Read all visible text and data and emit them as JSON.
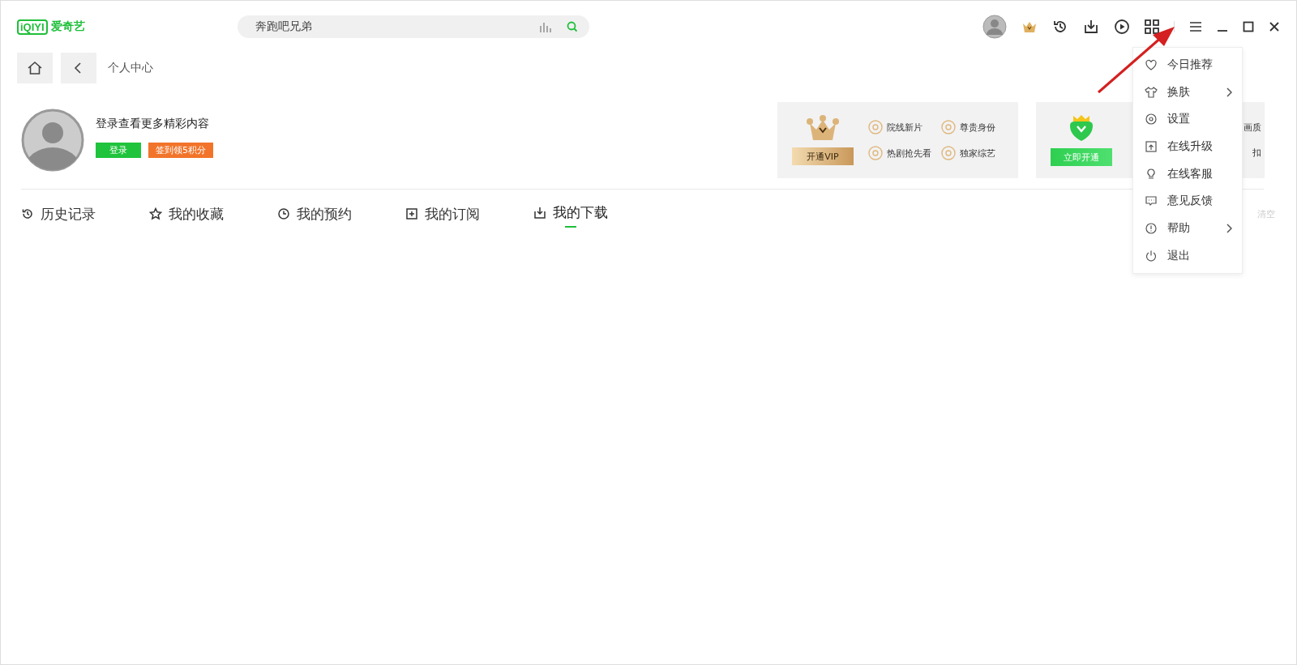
{
  "logo": {
    "mark": "iQIYI",
    "name": "爱奇艺"
  },
  "search": {
    "value": "奔跑吧兄弟"
  },
  "breadcrumb": {
    "title": "个人中心"
  },
  "profile": {
    "prompt": "登录查看更多精彩内容",
    "login_button": "登录",
    "checkin_button": "签到领5积分"
  },
  "vip_cards": [
    {
      "kind": "gold",
      "button": "开通VIP",
      "perks": [
        "院线新片",
        "尊贵身份",
        "热剧抢先看",
        "独家综艺"
      ]
    },
    {
      "kind": "green",
      "button": "立即开通",
      "perks": [
        "画质",
        "扣"
      ]
    }
  ],
  "tabs": [
    {
      "kind": "history",
      "label": "历史记录",
      "selected": false
    },
    {
      "kind": "star",
      "label": "我的收藏",
      "selected": false
    },
    {
      "kind": "clock",
      "label": "我的预约",
      "selected": false
    },
    {
      "kind": "plus",
      "label": "我的订阅",
      "selected": false
    },
    {
      "kind": "download",
      "label": "我的下载",
      "selected": true
    }
  ],
  "clear_button": "清空",
  "menu": [
    {
      "kind": "heart",
      "label": "今日推荐",
      "submenu": false
    },
    {
      "kind": "shirt",
      "label": "换肤",
      "submenu": true
    },
    {
      "kind": "gear",
      "label": "设置",
      "submenu": false
    },
    {
      "kind": "upgrade",
      "label": "在线升级",
      "submenu": false
    },
    {
      "kind": "bulb",
      "label": "在线客服",
      "submenu": false
    },
    {
      "kind": "chat",
      "label": "意见反馈",
      "submenu": false
    },
    {
      "kind": "info",
      "label": "帮助",
      "submenu": true
    },
    {
      "kind": "power",
      "label": "退出",
      "submenu": false
    }
  ]
}
